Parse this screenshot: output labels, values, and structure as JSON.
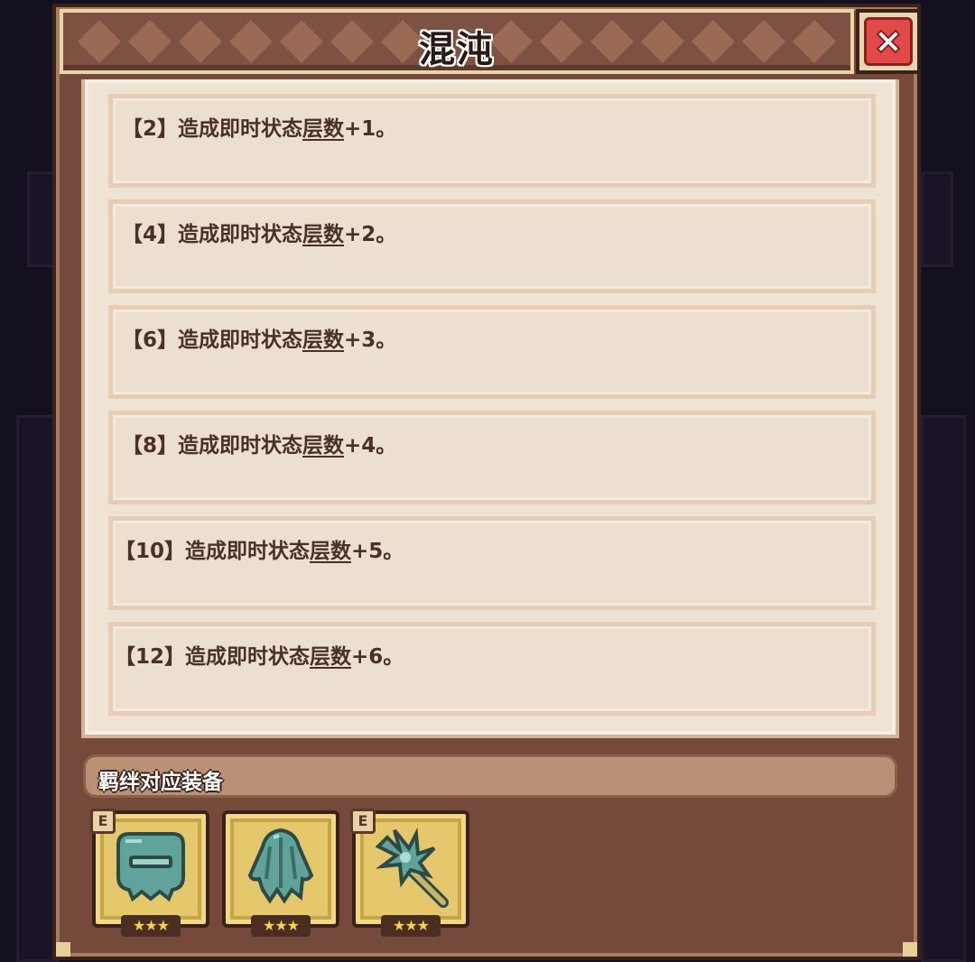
{
  "dialog": {
    "title": "混沌",
    "close_icon": "close-x-icon"
  },
  "bond_levels": [
    {
      "prefix": "【2】造成即时状态",
      "term": "层数",
      "suffix": "+1。"
    },
    {
      "prefix": "【4】造成即时状态",
      "term": "层数",
      "suffix": "+2。"
    },
    {
      "prefix": "【6】造成即时状态",
      "term": "层数",
      "suffix": "+3。"
    },
    {
      "prefix": "【8】造成即时状态",
      "term": "层数",
      "suffix": "+4。"
    },
    {
      "prefix": "【10】造成即时状态",
      "term": "层数",
      "suffix": "+5。"
    },
    {
      "prefix": "【12】造成即时状态",
      "term": "层数",
      "suffix": "+6。"
    }
  ],
  "equipment": {
    "header": "羁绊对应装备",
    "items": [
      {
        "icon": "mask-icon",
        "badge": "E",
        "stars": "★★★"
      },
      {
        "icon": "cloak-icon",
        "badge": "",
        "stars": "★★★"
      },
      {
        "icon": "staff-icon",
        "badge": "E",
        "stars": "★★★"
      }
    ]
  },
  "colors": {
    "frame": "#754a3b",
    "panel": "#efe4d4",
    "entry": "#ecdfcf",
    "text": "#4a3028",
    "slot_gold": "#e5c76c",
    "item_teal": "#5fa39a",
    "close_red": "#e24a4a"
  }
}
